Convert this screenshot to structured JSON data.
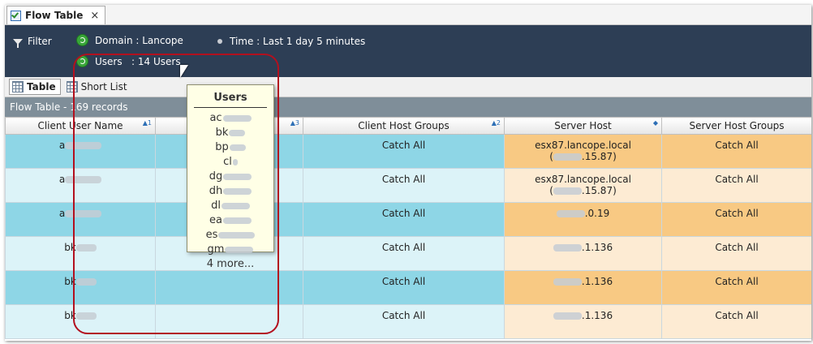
{
  "tab": {
    "title": "Flow Table",
    "close": "×"
  },
  "filter": {
    "label": "Filter",
    "domain": "Domain : Lancope",
    "time": "Time : Last 1 day 5 minutes",
    "users": "Users   : 14 Users"
  },
  "views": {
    "table": "Table",
    "short_list": "Short List"
  },
  "count_text": "Flow Table - 169 records",
  "columns": [
    {
      "label": "Client User Name",
      "sort": "▲1"
    },
    {
      "label": "",
      "sort": "▲3"
    },
    {
      "label": "Client Host Groups",
      "sort": "▲2"
    },
    {
      "label": "Server Host",
      "sort": "◆"
    },
    {
      "label": "Server Host Groups",
      "sort": ""
    }
  ],
  "rows": [
    {
      "user": "a",
      "host_group": "Catch All",
      "server_line1": "esx87.lancope.local",
      "server_line2_prefix": "(",
      "server_line2_suffix": ".15.87)",
      "server_group": "Catch All"
    },
    {
      "user": "a",
      "host_group": "Catch All",
      "server_line1": "esx87.lancope.local",
      "server_line2_prefix": "(",
      "server_line2_suffix": ".15.87)",
      "server_group": "Catch All"
    },
    {
      "user": "a",
      "host_group": "Catch All",
      "server_line1": "",
      "server_line2_prefix": "",
      "server_line2_suffix": ".0.19",
      "server_group": "Catch All"
    },
    {
      "user": "bk",
      "host_group": "Catch All",
      "server_line1": "",
      "server_line2_prefix": "",
      "server_line2_suffix": ".1.136",
      "server_group": "Catch All"
    },
    {
      "user": "bk",
      "host_group": "Catch All",
      "server_line1": "",
      "server_line2_prefix": "",
      "server_line2_suffix": ".1.136",
      "server_group": "Catch All"
    },
    {
      "user": "bk",
      "host_group": "Catch All",
      "server_line1": "",
      "server_line2_prefix": "",
      "server_line2_suffix": ".1.136",
      "server_group": "Catch All"
    }
  ],
  "popup": {
    "title": "Users",
    "users": [
      "ac",
      "bk",
      "bp",
      "cl",
      "dg",
      "dh",
      "dl",
      "ea",
      "es",
      "gm"
    ],
    "more": "4 more..."
  },
  "colors": {
    "filter_bar": "#2d3e55",
    "row_dark": "#8ed6e6",
    "row_light": "#dcf3f8",
    "server_dark": "#f8c983",
    "server_light": "#fdebd3",
    "highlight": "#b3101e"
  }
}
